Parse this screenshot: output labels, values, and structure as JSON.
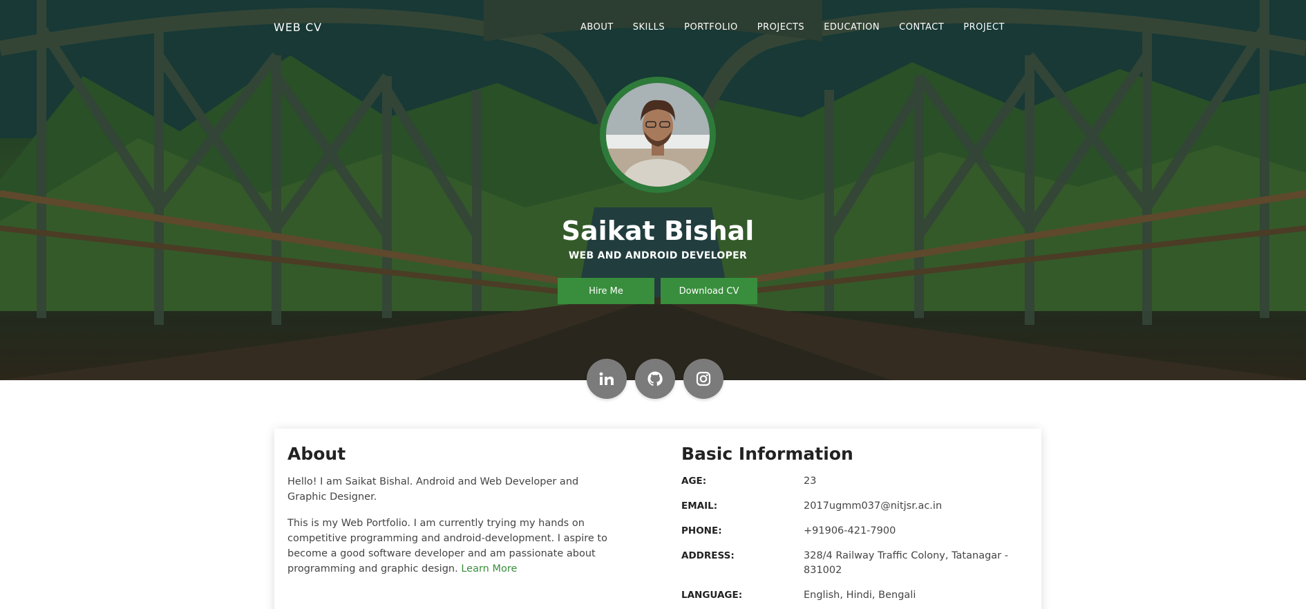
{
  "brand": "WEB CV",
  "nav": [
    "ABOUT",
    "SKILLS",
    "PORTFOLIO",
    "PROJECTS",
    "EDUCATION",
    "CONTACT",
    "PROJECT"
  ],
  "hero": {
    "name": "Saikat Bishal",
    "subtitle": "WEB AND ANDROID DEVELOPER",
    "hire_label": "Hire Me",
    "cv_label": "Download CV",
    "accent": "#388e3c"
  },
  "social": [
    {
      "icon": "linkedin-icon",
      "glyph": "in"
    },
    {
      "icon": "github-icon"
    },
    {
      "icon": "instagram-icon"
    }
  ],
  "about": {
    "title": "About",
    "p1": "Hello! I am Saikat Bishal. Android and Web Developer and Graphic Designer.",
    "p2": "This is my Web Portfolio. I am currently trying my hands on competitive programming and android-development. I aspire to become a good software developer and am passionate about programming and graphic design.",
    "learn_more": "Learn More"
  },
  "basic": {
    "title": "Basic Information",
    "rows": [
      {
        "label": "AGE:",
        "value": "23"
      },
      {
        "label": "EMAIL:",
        "value": "2017ugmm037@nitjsr.ac.in"
      },
      {
        "label": "PHONE:",
        "value": "+91906-421-7900"
      },
      {
        "label": "ADDRESS:",
        "value": "328/4 Railway Traffic Colony, Tatanagar - 831002"
      },
      {
        "label": "LANGUAGE:",
        "value": "English, Hindi, Bengali"
      }
    ]
  }
}
